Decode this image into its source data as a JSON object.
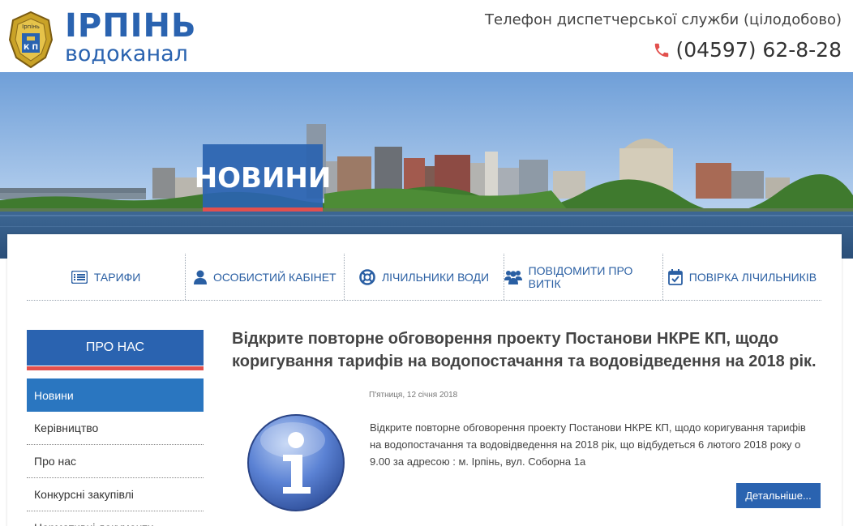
{
  "header": {
    "logo_title": "ІРПІНЬ",
    "logo_subtitle": "водоканал",
    "logo_emblem_text_top": "Ірпінь",
    "logo_emblem_text_mid": "К П",
    "phone_caption": "Телефон диспетчерської служби (цілодобово)",
    "phone_number": "(04597) 62-8-28",
    "phone_icon": "phone-icon"
  },
  "hero": {
    "title": "НОВИНИ"
  },
  "services": [
    {
      "label": "ТАРИФИ",
      "icon": "list-icon"
    },
    {
      "label": "ОСОБИСТИЙ КАБІНЕТ",
      "icon": "user-icon"
    },
    {
      "label": "ЛІЧИЛЬНИКИ ВОДИ",
      "icon": "lifebuoy-icon"
    },
    {
      "label": "ПОВІДОМИТИ ПРО ВИТІК",
      "icon": "users-icon"
    },
    {
      "label": "ПОВІРКА ЛІЧИЛЬНИКІВ",
      "icon": "calendar-check-icon"
    }
  ],
  "sidebar": {
    "heading": "ПРО НАС",
    "items": [
      {
        "label": "Новини",
        "active": true
      },
      {
        "label": "Керівництво"
      },
      {
        "label": "Про нас"
      },
      {
        "label": "Конкурсні закупівлі"
      },
      {
        "label": "Нормативні документи"
      }
    ]
  },
  "article": {
    "title": "Відкрите повторне обговорення проекту Постанови НКРЕ КП, щодо коригування тарифів на водопостачання та водовідведення на 2018 рік.",
    "date": "П'ятниця, 12 січня 2018",
    "text": "Відкрите повторне обговорення проекту Постанови НКРЕ КП, щодо коригування тарифів на водопостачання та водовідведення на 2018 рік, що відбудеться 6 лютого 2018 року о 9.00 за адресою : м. Ірпінь, вул. Соборна 1а",
    "more_label": "Детальніше...",
    "icon": "info-icon"
  },
  "colors": {
    "brand_blue": "#2a63b0",
    "active_blue": "#2a76c0",
    "accent_red": "#e2504d"
  }
}
